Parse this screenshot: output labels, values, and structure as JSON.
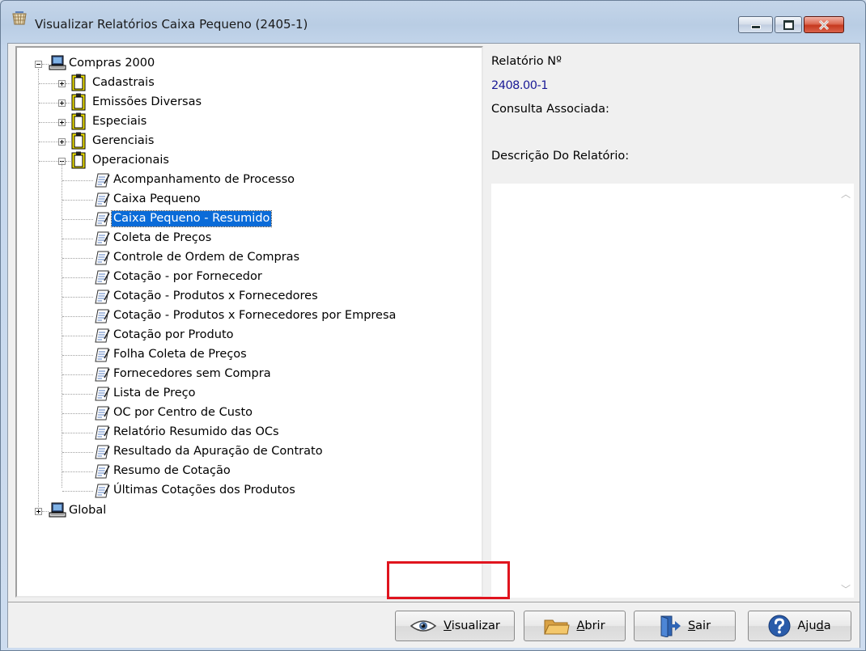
{
  "window": {
    "title": "Visualizar Relatórios Caixa Pequeno (2405-1)",
    "icon": "report-basket-icon",
    "close_color": "#c6391f"
  },
  "tree": {
    "root": {
      "label": "Compras 2000",
      "icon": "computer-icon",
      "expanded": true
    },
    "groups": [
      {
        "label": "Cadastrais",
        "expanded": false
      },
      {
        "label": "Emissões Diversas",
        "expanded": false
      },
      {
        "label": "Especiais",
        "expanded": false
      },
      {
        "label": "Gerenciais",
        "expanded": false
      },
      {
        "label": "Operacionais",
        "expanded": true
      }
    ],
    "reports": [
      "Acompanhamento de Processo",
      "Caixa Pequeno",
      "Caixa Pequeno - Resumido",
      "Coleta de Preços",
      "Controle de Ordem de Compras",
      "Cotação - por Fornecedor",
      "Cotação - Produtos x Fornecedores",
      "Cotação - Produtos x Fornecedores por Empresa",
      "Cotação por Produto",
      "Folha Coleta de Preços",
      "Fornecedores sem Compra",
      "Lista de Preço",
      "OC por Centro de Custo",
      "Relatório Resumido das OCs",
      "Resultado da Apuração de Contrato",
      "Resumo de Cotação",
      "Últimas Cotações dos Produtos"
    ],
    "selected_report": "Caixa Pequeno - Resumido",
    "global": {
      "label": "Global",
      "expanded": false
    },
    "selection_color": "#0a6bd8"
  },
  "details": {
    "report_no_label": "Relatório Nº",
    "report_no_value": "2408.00-1",
    "query_label": "Consulta Associada:",
    "description_label": "Descrição Do Relatório:"
  },
  "buttons": {
    "visualizar": {
      "prefix": "",
      "mnemonic": "V",
      "rest": "isualizar",
      "icon": "eye-icon"
    },
    "abrir": {
      "prefix": "",
      "mnemonic": "A",
      "rest": "brir",
      "icon": "folder-icon"
    },
    "sair": {
      "prefix": "",
      "mnemonic": "S",
      "rest": "air",
      "icon": "exit-door-icon"
    },
    "ajuda": {
      "prefix": "Aju",
      "mnemonic": "d",
      "rest": "a",
      "icon": "help-icon"
    }
  },
  "highlight_color": "#e0141e"
}
